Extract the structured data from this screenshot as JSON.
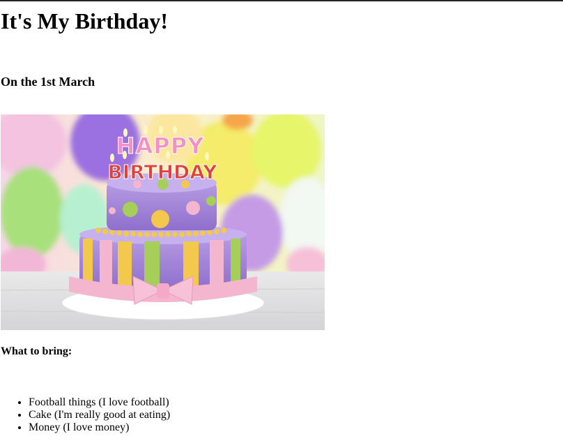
{
  "page": {
    "title": "It's My Birthday!",
    "date_heading": "On the 1st March",
    "bring_heading": "What to bring:",
    "bring_items": [
      "Football things (I love football)",
      "Cake (I'm really good at eating)",
      "Money (I love money)"
    ]
  },
  "photo": {
    "topper_word_1": "HAPPY",
    "topper_word_2": "BIRTHDAY",
    "colors": {
      "cake_purple": "#a98ad6",
      "cake_pink": "#f4b6cf",
      "cake_yellow": "#f2c94c",
      "cake_green": "#a6cf5a",
      "balloon_purple": "#9b6fe0",
      "balloon_yellow": "#e8f05a",
      "balloon_green": "#9fe07a"
    }
  }
}
